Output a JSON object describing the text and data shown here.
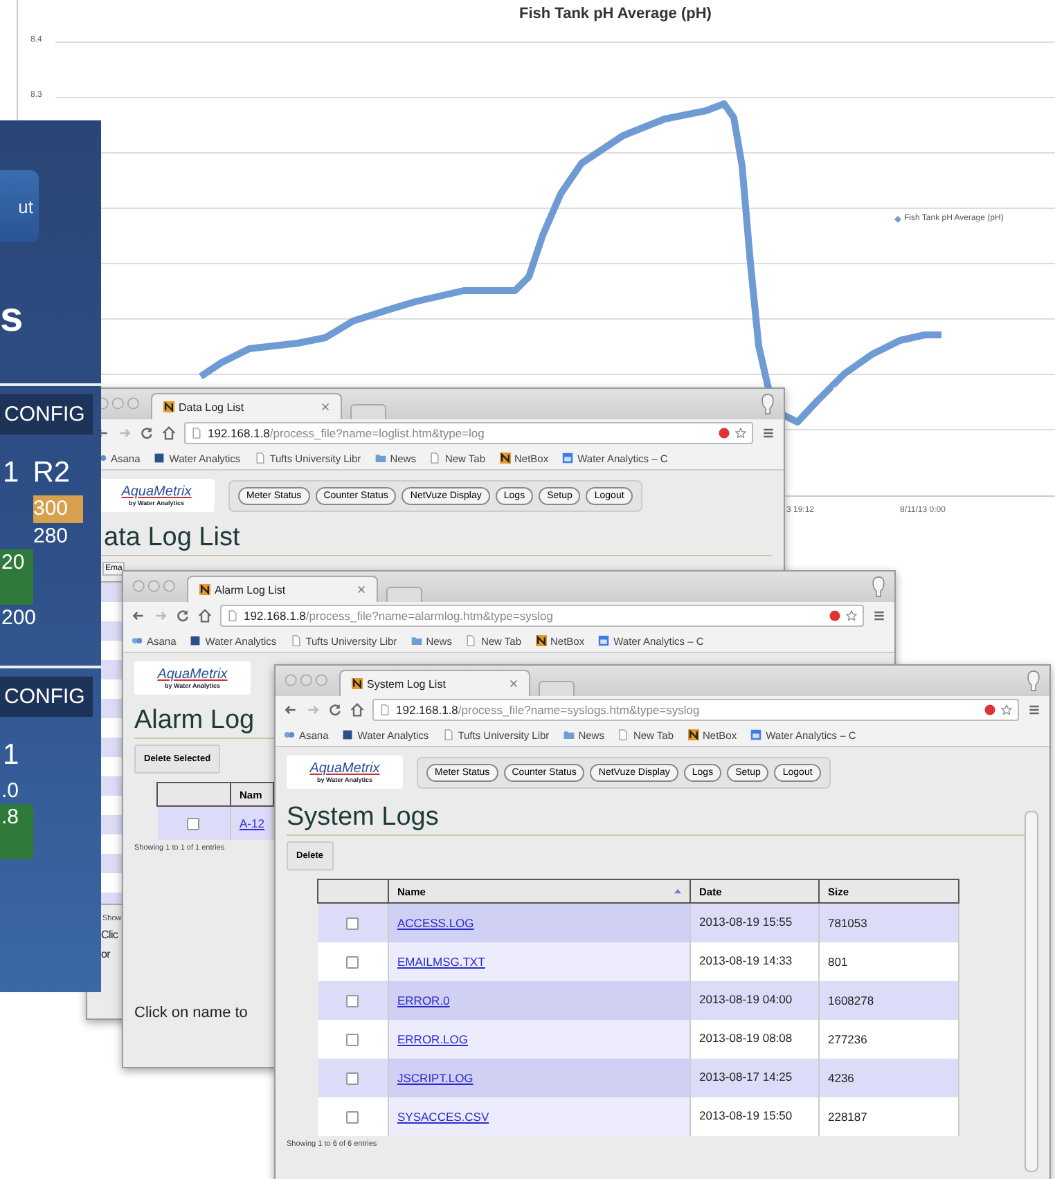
{
  "chart": {
    "title": "Fish Tank pH Average (pH)",
    "y_tick_labels": [
      "8.4",
      "8.3"
    ],
    "legend": "Fish Tank pH Average (pH)",
    "x_tick_labels": [
      "3 19:12",
      "8/11/13 0:00"
    ]
  },
  "side_panel": {
    "button": "ut",
    "heading": "s",
    "sections": [
      {
        "tab": "CONFIG",
        "column_labels": [
          "1",
          "R2"
        ],
        "cells": [
          {
            "kind": "right_column",
            "text": "300",
            "color": "#d6a04c"
          },
          {
            "kind": "right_column",
            "text": "280"
          },
          {
            "kind": "left_column",
            "text": "20",
            "color": "#2f7a3a"
          },
          {
            "kind": "left_column",
            "text": "200"
          }
        ]
      },
      {
        "tab": "CONFIG",
        "column_labels": [
          "1"
        ],
        "cells": [
          {
            "kind": "left_column",
            "text": ".0"
          },
          {
            "kind": "left_column",
            "text": ".8",
            "color": "#2f7a3a"
          }
        ]
      }
    ]
  },
  "windows": [
    {
      "kind": "data_log",
      "tab_title": "Data Log List",
      "url": "**192.168.1.8**/process_file?name=loglist.htm&type=log",
      "bookmarks": [
        {
          "kind": "app",
          "label": "Asana"
        },
        {
          "kind": "site",
          "label": "Water Analytics"
        },
        {
          "kind": "page",
          "label": "Tufts University Libr"
        },
        {
          "kind": "folder",
          "label": "News"
        },
        {
          "kind": "page",
          "label": "New Tab"
        },
        {
          "kind": "netbox",
          "label": "NetBox"
        },
        {
          "kind": "calendar",
          "label": "Water Analytics – C"
        }
      ],
      "logo": {
        "name": "AquaMetrix",
        "tagline": "by Water Analytics"
      },
      "nav_buttons": [
        "Meter Status",
        "Counter Status",
        "NetVuze Display",
        "Logs",
        "Setup",
        "Logout"
      ],
      "heading": "ata Log List",
      "fragments": {
        "tab": "Ema",
        "footer": "Show",
        "note_lines": [
          "Clic",
          "or"
        ]
      }
    },
    {
      "kind": "alarm_log",
      "tab_title": "Alarm Log List",
      "url": "**192.168.1.8**/process_file?name=alarmlog.htm&type=syslog",
      "bookmarks": [
        {
          "kind": "app",
          "label": "Asana"
        },
        {
          "kind": "site",
          "label": "Water Analytics"
        },
        {
          "kind": "page",
          "label": "Tufts University Libr"
        },
        {
          "kind": "folder",
          "label": "News"
        },
        {
          "kind": "page",
          "label": "New Tab"
        },
        {
          "kind": "netbox",
          "label": "NetBox"
        },
        {
          "kind": "calendar",
          "label": "Water Analytics – C"
        }
      ],
      "logo": {
        "name": "AquaMetrix",
        "tagline": "by Water Analytics"
      },
      "heading": "Alarm Log",
      "delete_button": "Delete Selected",
      "table": {
        "columns": [
          "Nam"
        ],
        "rows": [
          {
            "checked": false,
            "name": "A-12"
          }
        ],
        "footer": "Showing 1 to 1 of 1 entries"
      },
      "note": "Click on name to"
    },
    {
      "kind": "system_log",
      "tab_title": "System Log List",
      "url": "**192.168.1.8**/process_file?name=syslogs.htm&type=syslog",
      "bookmarks": [
        {
          "kind": "app",
          "label": "Asana"
        },
        {
          "kind": "site",
          "label": "Water Analytics"
        },
        {
          "kind": "page",
          "label": "Tufts University Libr"
        },
        {
          "kind": "folder",
          "label": "News"
        },
        {
          "kind": "page",
          "label": "New Tab"
        },
        {
          "kind": "netbox",
          "label": "NetBox"
        },
        {
          "kind": "calendar",
          "label": "Water Analytics – C"
        }
      ],
      "logo": {
        "name": "AquaMetrix",
        "tagline": "by Water Analytics"
      },
      "nav_buttons": [
        "Meter Status",
        "Counter Status",
        "NetVuze Display",
        "Logs",
        "Setup",
        "Logout"
      ],
      "heading": "System Logs",
      "delete_button": "Delete",
      "table": {
        "columns": [
          "Name",
          "Date",
          "Size"
        ],
        "rows": [
          {
            "checked": false,
            "name": "ACCESS.LOG",
            "date": "2013-08-19 15:55",
            "size": "781053"
          },
          {
            "checked": false,
            "name": "EMAILMSG.TXT",
            "date": "2013-08-19 14:33",
            "size": "801"
          },
          {
            "checked": false,
            "name": "ERROR.0",
            "date": "2013-08-19 04:00",
            "size": "1608278"
          },
          {
            "checked": false,
            "name": "ERROR.LOG",
            "date": "2013-08-19 08:08",
            "size": "277236"
          },
          {
            "checked": false,
            "name": "JSCRIPT.LOG",
            "date": "2013-08-17 14:25",
            "size": "4236"
          },
          {
            "checked": false,
            "name": "SYSACCES.CSV",
            "date": "2013-08-19 15:50",
            "size": "228187"
          }
        ],
        "footer": "Showing 1 to 6 of 6 entries"
      }
    }
  ]
}
